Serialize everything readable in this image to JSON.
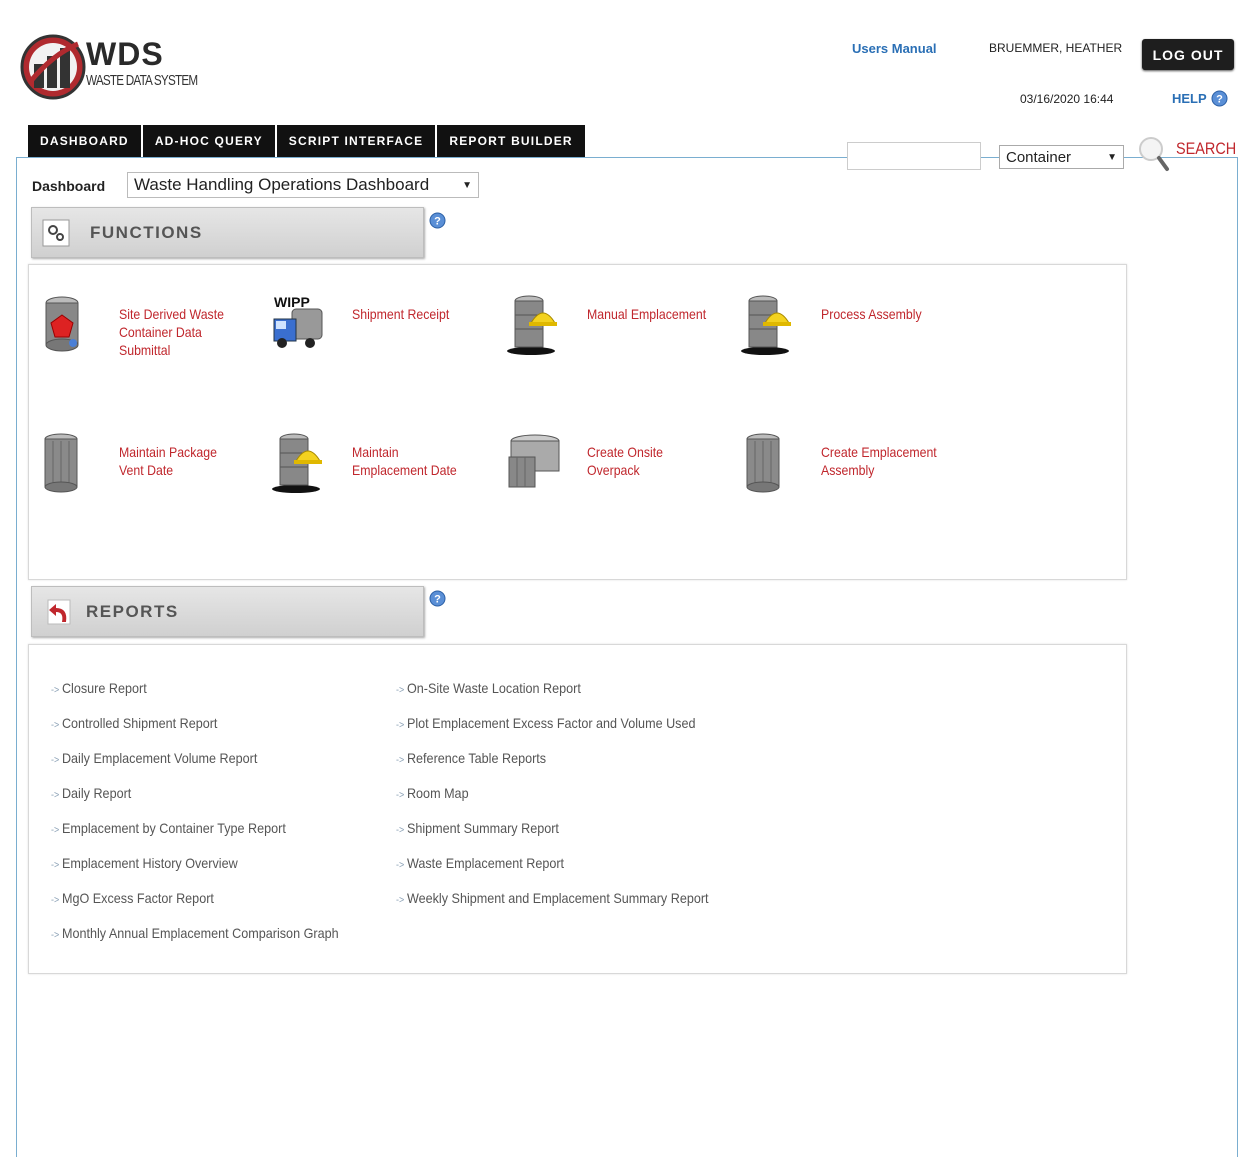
{
  "logo": {
    "title": "WDS",
    "subtitle": "WASTE DATA SYSTEM"
  },
  "header": {
    "users_manual": "Users Manual",
    "user_name": "BRUEMMER, HEATHER",
    "logout": "LOG OUT",
    "datetime": "03/16/2020 16:44",
    "help": "HELP"
  },
  "tabs": [
    "DASHBOARD",
    "AD-HOC QUERY",
    "SCRIPT INTERFACE",
    "REPORT BUILDER"
  ],
  "search": {
    "value": "",
    "type": "Container",
    "label": "SEARCH"
  },
  "dashboard": {
    "label": "Dashboard",
    "selected": "Waste Handling Operations Dashboard"
  },
  "functions": {
    "title": "FUNCTIONS",
    "items": [
      {
        "label": "Site Derived Waste Container Data Submittal",
        "icon": "database-submit-icon"
      },
      {
        "label": "Shipment Receipt",
        "icon": "wipp-truck-icon",
        "icon_text": "WIPP"
      },
      {
        "label": "Manual Emplacement",
        "icon": "database-helmet-icon"
      },
      {
        "label": "Process Assembly",
        "icon": "database-helmet-icon"
      },
      {
        "label": "Maintain Package Vent Date",
        "icon": "drum-icon"
      },
      {
        "label": "Maintain Emplacement Date",
        "icon": "database-helmet-icon"
      },
      {
        "label": "Create Onsite Overpack",
        "icon": "overpack-icon"
      },
      {
        "label": "Create Emplacement Assembly",
        "icon": "drum-icon"
      }
    ]
  },
  "reports": {
    "title": "REPORTS",
    "left": [
      "Closure Report",
      "Controlled Shipment Report",
      "Daily Emplacement Volume Report",
      "Daily Report",
      "Emplacement by Container Type Report",
      "Emplacement History Overview",
      "MgO Excess Factor Report",
      "Monthly Annual Emplacement Comparison Graph"
    ],
    "right": [
      "On-Site Waste Location Report",
      "Plot Emplacement Excess Factor and Volume Used",
      "Reference Table Reports",
      "Room Map",
      "Shipment Summary Report",
      "Waste Emplacement Report",
      "Weekly Shipment and Emplacement Summary Report"
    ]
  },
  "colors": {
    "link_red": "#c0272d",
    "link_blue": "#2a6fb5",
    "frame_border": "#7aaed0"
  }
}
